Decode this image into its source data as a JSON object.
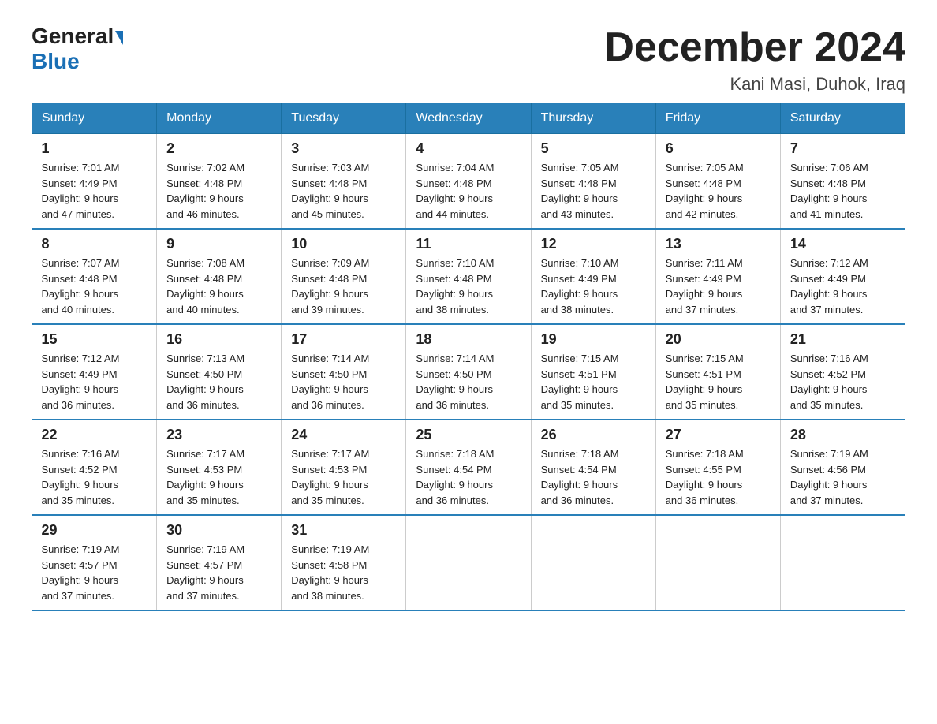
{
  "logo": {
    "general": "General",
    "blue": "Blue"
  },
  "title": "December 2024",
  "subtitle": "Kani Masi, Duhok, Iraq",
  "weekdays": [
    "Sunday",
    "Monday",
    "Tuesday",
    "Wednesday",
    "Thursday",
    "Friday",
    "Saturday"
  ],
  "weeks": [
    [
      {
        "day": "1",
        "sunrise": "7:01 AM",
        "sunset": "4:49 PM",
        "daylight": "9 hours and 47 minutes."
      },
      {
        "day": "2",
        "sunrise": "7:02 AM",
        "sunset": "4:48 PM",
        "daylight": "9 hours and 46 minutes."
      },
      {
        "day": "3",
        "sunrise": "7:03 AM",
        "sunset": "4:48 PM",
        "daylight": "9 hours and 45 minutes."
      },
      {
        "day": "4",
        "sunrise": "7:04 AM",
        "sunset": "4:48 PM",
        "daylight": "9 hours and 44 minutes."
      },
      {
        "day": "5",
        "sunrise": "7:05 AM",
        "sunset": "4:48 PM",
        "daylight": "9 hours and 43 minutes."
      },
      {
        "day": "6",
        "sunrise": "7:05 AM",
        "sunset": "4:48 PM",
        "daylight": "9 hours and 42 minutes."
      },
      {
        "day": "7",
        "sunrise": "7:06 AM",
        "sunset": "4:48 PM",
        "daylight": "9 hours and 41 minutes."
      }
    ],
    [
      {
        "day": "8",
        "sunrise": "7:07 AM",
        "sunset": "4:48 PM",
        "daylight": "9 hours and 40 minutes."
      },
      {
        "day": "9",
        "sunrise": "7:08 AM",
        "sunset": "4:48 PM",
        "daylight": "9 hours and 40 minutes."
      },
      {
        "day": "10",
        "sunrise": "7:09 AM",
        "sunset": "4:48 PM",
        "daylight": "9 hours and 39 minutes."
      },
      {
        "day": "11",
        "sunrise": "7:10 AM",
        "sunset": "4:48 PM",
        "daylight": "9 hours and 38 minutes."
      },
      {
        "day": "12",
        "sunrise": "7:10 AM",
        "sunset": "4:49 PM",
        "daylight": "9 hours and 38 minutes."
      },
      {
        "day": "13",
        "sunrise": "7:11 AM",
        "sunset": "4:49 PM",
        "daylight": "9 hours and 37 minutes."
      },
      {
        "day": "14",
        "sunrise": "7:12 AM",
        "sunset": "4:49 PM",
        "daylight": "9 hours and 37 minutes."
      }
    ],
    [
      {
        "day": "15",
        "sunrise": "7:12 AM",
        "sunset": "4:49 PM",
        "daylight": "9 hours and 36 minutes."
      },
      {
        "day": "16",
        "sunrise": "7:13 AM",
        "sunset": "4:50 PM",
        "daylight": "9 hours and 36 minutes."
      },
      {
        "day": "17",
        "sunrise": "7:14 AM",
        "sunset": "4:50 PM",
        "daylight": "9 hours and 36 minutes."
      },
      {
        "day": "18",
        "sunrise": "7:14 AM",
        "sunset": "4:50 PM",
        "daylight": "9 hours and 36 minutes."
      },
      {
        "day": "19",
        "sunrise": "7:15 AM",
        "sunset": "4:51 PM",
        "daylight": "9 hours and 35 minutes."
      },
      {
        "day": "20",
        "sunrise": "7:15 AM",
        "sunset": "4:51 PM",
        "daylight": "9 hours and 35 minutes."
      },
      {
        "day": "21",
        "sunrise": "7:16 AM",
        "sunset": "4:52 PM",
        "daylight": "9 hours and 35 minutes."
      }
    ],
    [
      {
        "day": "22",
        "sunrise": "7:16 AM",
        "sunset": "4:52 PM",
        "daylight": "9 hours and 35 minutes."
      },
      {
        "day": "23",
        "sunrise": "7:17 AM",
        "sunset": "4:53 PM",
        "daylight": "9 hours and 35 minutes."
      },
      {
        "day": "24",
        "sunrise": "7:17 AM",
        "sunset": "4:53 PM",
        "daylight": "9 hours and 35 minutes."
      },
      {
        "day": "25",
        "sunrise": "7:18 AM",
        "sunset": "4:54 PM",
        "daylight": "9 hours and 36 minutes."
      },
      {
        "day": "26",
        "sunrise": "7:18 AM",
        "sunset": "4:54 PM",
        "daylight": "9 hours and 36 minutes."
      },
      {
        "day": "27",
        "sunrise": "7:18 AM",
        "sunset": "4:55 PM",
        "daylight": "9 hours and 36 minutes."
      },
      {
        "day": "28",
        "sunrise": "7:19 AM",
        "sunset": "4:56 PM",
        "daylight": "9 hours and 37 minutes."
      }
    ],
    [
      {
        "day": "29",
        "sunrise": "7:19 AM",
        "sunset": "4:57 PM",
        "daylight": "9 hours and 37 minutes."
      },
      {
        "day": "30",
        "sunrise": "7:19 AM",
        "sunset": "4:57 PM",
        "daylight": "9 hours and 37 minutes."
      },
      {
        "day": "31",
        "sunrise": "7:19 AM",
        "sunset": "4:58 PM",
        "daylight": "9 hours and 38 minutes."
      },
      null,
      null,
      null,
      null
    ]
  ],
  "labels": {
    "sunrise": "Sunrise:",
    "sunset": "Sunset:",
    "daylight": "Daylight:"
  }
}
